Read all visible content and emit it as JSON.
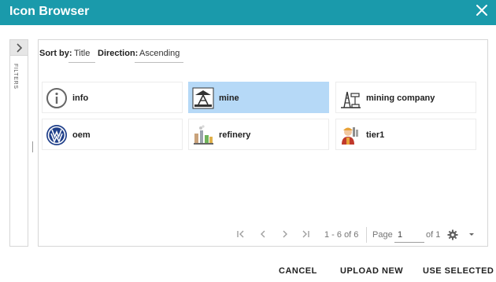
{
  "dialog": {
    "title": "Icon Browser",
    "close_icon": "close-icon"
  },
  "filters": {
    "label": "FILTERS",
    "toggle_icon": "chevron-right-icon"
  },
  "sort": {
    "sort_by_label": "Sort by:",
    "sort_by_value": "Title",
    "direction_label": "Direction:",
    "direction_value": "Ascending"
  },
  "icons": [
    {
      "label": "info",
      "icon": "info-circle-icon",
      "selected": false
    },
    {
      "label": "mine",
      "icon": "mine-icon",
      "selected": true
    },
    {
      "label": "mining company",
      "icon": "oil-derrick-icon",
      "selected": false
    },
    {
      "label": "oem",
      "icon": "vw-logo-icon",
      "selected": false
    },
    {
      "label": "refinery",
      "icon": "refinery-icon",
      "selected": false
    },
    {
      "label": "tier1",
      "icon": "worker-icon",
      "selected": false
    }
  ],
  "pager": {
    "range": "1 - 6 of 6",
    "page_label": "Page",
    "page_value": "1",
    "of_label": "of 1"
  },
  "footer": {
    "cancel": "CANCEL",
    "upload": "UPLOAD NEW",
    "use_selected": "USE SELECTED"
  },
  "colors": {
    "header": "#1a9aab",
    "selected_tile": "#b6d9f7"
  }
}
